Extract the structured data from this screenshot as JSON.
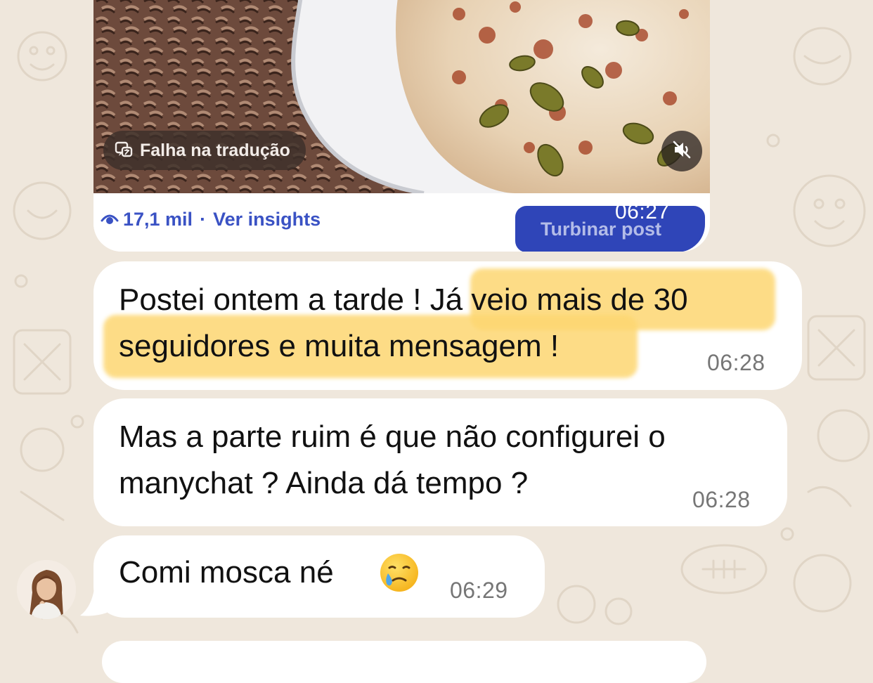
{
  "post": {
    "translation_chip_label": "Falha na tradução",
    "views": "17,1 mil",
    "separator": "·",
    "insights_link": "Ver insights",
    "boost_button_label": "Turbinar post",
    "time": "06:27"
  },
  "messages": [
    {
      "text_plain": "Postei ontem a tarde !",
      "text_highlighted_line1": "Já veio mais de 30",
      "text_highlighted_line2": "seguidores e muita mensagem !",
      "time": "06:28"
    },
    {
      "line1": "Mas a parte ruim é que não configurei o",
      "line2": "manychat ? Ainda dá tempo ?",
      "time": "06:28"
    },
    {
      "text": "Comi mosca né",
      "emoji": "🥲",
      "time": "06:29"
    }
  ],
  "colors": {
    "chat_background": "#efe7dc",
    "bubble": "#ffffff",
    "highlight": "#fdd772",
    "link_blue": "#3a52c4",
    "boost_button": "#2f45b8",
    "timestamp": "#767676"
  },
  "icons": [
    "translate-icon",
    "mute-icon",
    "eye-icon",
    "avatar"
  ]
}
